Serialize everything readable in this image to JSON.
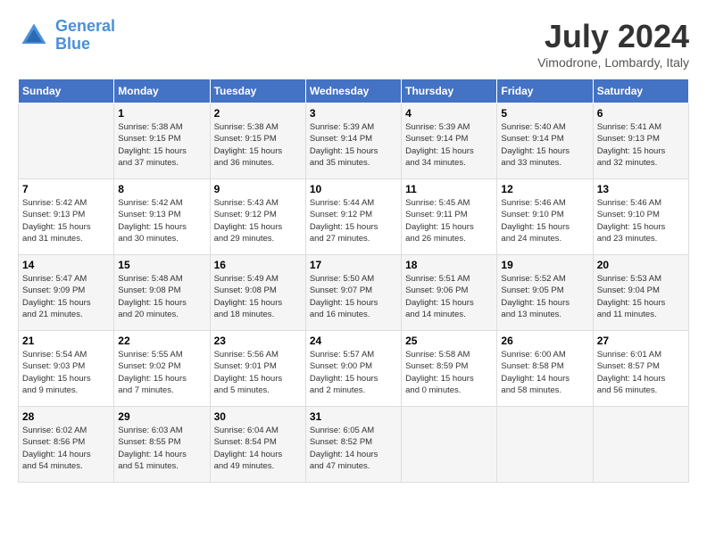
{
  "header": {
    "logo_line1": "General",
    "logo_line2": "Blue",
    "month_title": "July 2024",
    "location": "Vimodrone, Lombardy, Italy"
  },
  "days_of_week": [
    "Sunday",
    "Monday",
    "Tuesday",
    "Wednesday",
    "Thursday",
    "Friday",
    "Saturday"
  ],
  "weeks": [
    [
      {
        "day": "",
        "info": ""
      },
      {
        "day": "1",
        "info": "Sunrise: 5:38 AM\nSunset: 9:15 PM\nDaylight: 15 hours\nand 37 minutes."
      },
      {
        "day": "2",
        "info": "Sunrise: 5:38 AM\nSunset: 9:15 PM\nDaylight: 15 hours\nand 36 minutes."
      },
      {
        "day": "3",
        "info": "Sunrise: 5:39 AM\nSunset: 9:14 PM\nDaylight: 15 hours\nand 35 minutes."
      },
      {
        "day": "4",
        "info": "Sunrise: 5:39 AM\nSunset: 9:14 PM\nDaylight: 15 hours\nand 34 minutes."
      },
      {
        "day": "5",
        "info": "Sunrise: 5:40 AM\nSunset: 9:14 PM\nDaylight: 15 hours\nand 33 minutes."
      },
      {
        "day": "6",
        "info": "Sunrise: 5:41 AM\nSunset: 9:13 PM\nDaylight: 15 hours\nand 32 minutes."
      }
    ],
    [
      {
        "day": "7",
        "info": "Sunrise: 5:42 AM\nSunset: 9:13 PM\nDaylight: 15 hours\nand 31 minutes."
      },
      {
        "day": "8",
        "info": "Sunrise: 5:42 AM\nSunset: 9:13 PM\nDaylight: 15 hours\nand 30 minutes."
      },
      {
        "day": "9",
        "info": "Sunrise: 5:43 AM\nSunset: 9:12 PM\nDaylight: 15 hours\nand 29 minutes."
      },
      {
        "day": "10",
        "info": "Sunrise: 5:44 AM\nSunset: 9:12 PM\nDaylight: 15 hours\nand 27 minutes."
      },
      {
        "day": "11",
        "info": "Sunrise: 5:45 AM\nSunset: 9:11 PM\nDaylight: 15 hours\nand 26 minutes."
      },
      {
        "day": "12",
        "info": "Sunrise: 5:46 AM\nSunset: 9:10 PM\nDaylight: 15 hours\nand 24 minutes."
      },
      {
        "day": "13",
        "info": "Sunrise: 5:46 AM\nSunset: 9:10 PM\nDaylight: 15 hours\nand 23 minutes."
      }
    ],
    [
      {
        "day": "14",
        "info": "Sunrise: 5:47 AM\nSunset: 9:09 PM\nDaylight: 15 hours\nand 21 minutes."
      },
      {
        "day": "15",
        "info": "Sunrise: 5:48 AM\nSunset: 9:08 PM\nDaylight: 15 hours\nand 20 minutes."
      },
      {
        "day": "16",
        "info": "Sunrise: 5:49 AM\nSunset: 9:08 PM\nDaylight: 15 hours\nand 18 minutes."
      },
      {
        "day": "17",
        "info": "Sunrise: 5:50 AM\nSunset: 9:07 PM\nDaylight: 15 hours\nand 16 minutes."
      },
      {
        "day": "18",
        "info": "Sunrise: 5:51 AM\nSunset: 9:06 PM\nDaylight: 15 hours\nand 14 minutes."
      },
      {
        "day": "19",
        "info": "Sunrise: 5:52 AM\nSunset: 9:05 PM\nDaylight: 15 hours\nand 13 minutes."
      },
      {
        "day": "20",
        "info": "Sunrise: 5:53 AM\nSunset: 9:04 PM\nDaylight: 15 hours\nand 11 minutes."
      }
    ],
    [
      {
        "day": "21",
        "info": "Sunrise: 5:54 AM\nSunset: 9:03 PM\nDaylight: 15 hours\nand 9 minutes."
      },
      {
        "day": "22",
        "info": "Sunrise: 5:55 AM\nSunset: 9:02 PM\nDaylight: 15 hours\nand 7 minutes."
      },
      {
        "day": "23",
        "info": "Sunrise: 5:56 AM\nSunset: 9:01 PM\nDaylight: 15 hours\nand 5 minutes."
      },
      {
        "day": "24",
        "info": "Sunrise: 5:57 AM\nSunset: 9:00 PM\nDaylight: 15 hours\nand 2 minutes."
      },
      {
        "day": "25",
        "info": "Sunrise: 5:58 AM\nSunset: 8:59 PM\nDaylight: 15 hours\nand 0 minutes."
      },
      {
        "day": "26",
        "info": "Sunrise: 6:00 AM\nSunset: 8:58 PM\nDaylight: 14 hours\nand 58 minutes."
      },
      {
        "day": "27",
        "info": "Sunrise: 6:01 AM\nSunset: 8:57 PM\nDaylight: 14 hours\nand 56 minutes."
      }
    ],
    [
      {
        "day": "28",
        "info": "Sunrise: 6:02 AM\nSunset: 8:56 PM\nDaylight: 14 hours\nand 54 minutes."
      },
      {
        "day": "29",
        "info": "Sunrise: 6:03 AM\nSunset: 8:55 PM\nDaylight: 14 hours\nand 51 minutes."
      },
      {
        "day": "30",
        "info": "Sunrise: 6:04 AM\nSunset: 8:54 PM\nDaylight: 14 hours\nand 49 minutes."
      },
      {
        "day": "31",
        "info": "Sunrise: 6:05 AM\nSunset: 8:52 PM\nDaylight: 14 hours\nand 47 minutes."
      },
      {
        "day": "",
        "info": ""
      },
      {
        "day": "",
        "info": ""
      },
      {
        "day": "",
        "info": ""
      }
    ]
  ]
}
